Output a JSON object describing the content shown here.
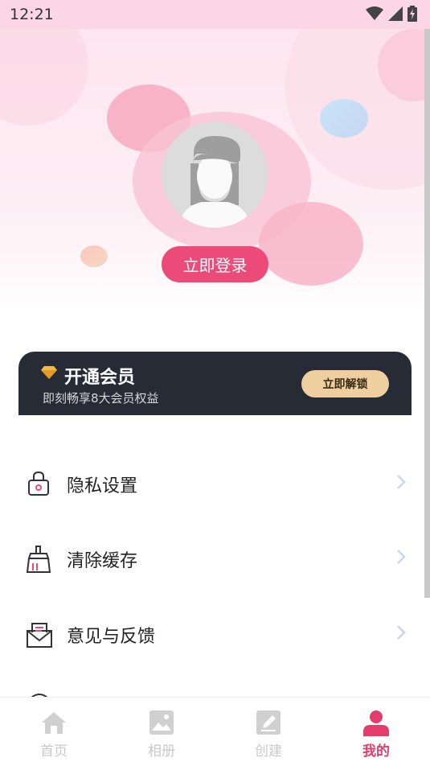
{
  "status_bar": {
    "time": "12:21"
  },
  "profile": {
    "login_button": "立即登录"
  },
  "vip": {
    "title": "开通会员",
    "subtitle": "即刻畅享8大会员权益",
    "button": "立即解锁"
  },
  "menu": [
    {
      "label": "隐私设置",
      "icon": "lock-icon"
    },
    {
      "label": "清除缓存",
      "icon": "broom-icon"
    },
    {
      "label": "意见与反馈",
      "icon": "mail-icon"
    }
  ],
  "tabs": [
    {
      "label": "首页",
      "icon": "home-icon",
      "active": false
    },
    {
      "label": "相册",
      "icon": "image-icon",
      "active": false
    },
    {
      "label": "创建",
      "icon": "edit-icon",
      "active": false
    },
    {
      "label": "我的",
      "icon": "user-icon",
      "active": true
    }
  ],
  "colors": {
    "accent": "#ec4a78",
    "tab_active": "#e23d6c",
    "vip_bg": "#262b35",
    "vip_button": "#efcf9f"
  }
}
